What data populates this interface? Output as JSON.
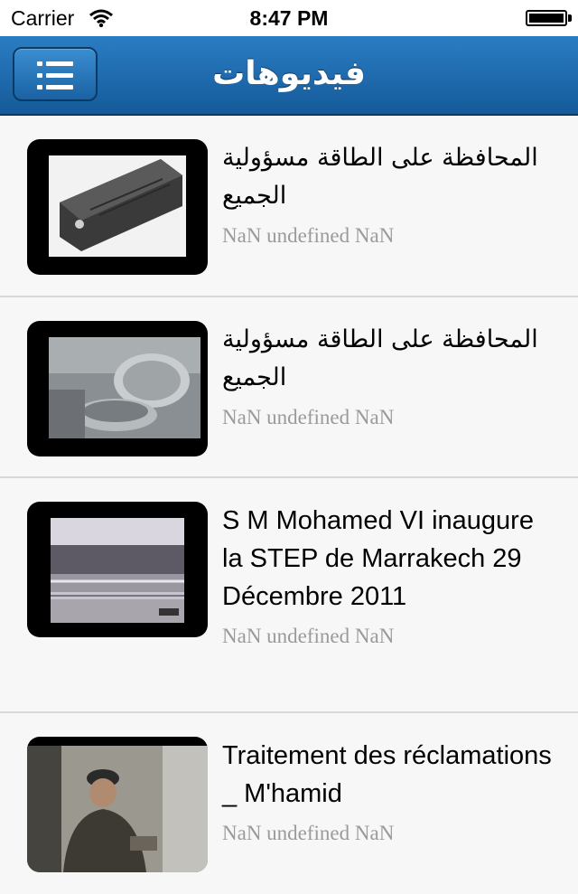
{
  "status": {
    "carrier": "Carrier",
    "time": "8:47 PM"
  },
  "nav": {
    "title": "فيديوهات",
    "menu_icon": "list-menu-icon"
  },
  "videos": [
    {
      "title": "المحافظة على الطاقة مسؤولية الجميع",
      "subtitle": "NaN undefined NaN",
      "thumb": "ups-device"
    },
    {
      "title": "المحافظة على الطاقة مسؤولية الجميع",
      "subtitle": "NaN undefined NaN",
      "thumb": "kitchen-sink-pots"
    },
    {
      "title": "S M Mohamed VI inaugure la STEP de Marrakech 29 Décembre 2011",
      "subtitle": "NaN undefined NaN",
      "thumb": "people-at-treatment-plant"
    },
    {
      "title": "Traitement des réclamations _ M'hamid",
      "subtitle": "NaN undefined NaN",
      "thumb": "man-in-cap-outdoors"
    }
  ]
}
